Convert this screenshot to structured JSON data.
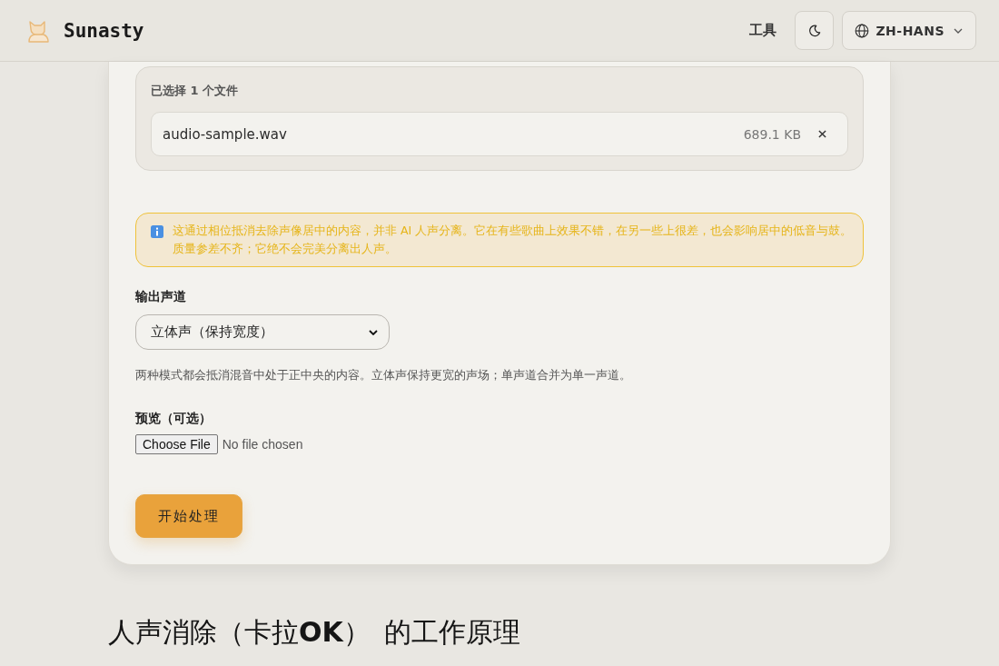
{
  "header": {
    "brand": "Sunasty",
    "nav_link": "工具",
    "language": {
      "label": "ZH-HANS"
    }
  },
  "file_panel": {
    "title": "已选择 1 个文件",
    "files": [
      {
        "name": "audio-sample.wav",
        "size": "689.1 KB"
      }
    ]
  },
  "notice": {
    "text": "这通过相位抵消去除声像居中的内容，并非 AI 人声分离。它在有些歌曲上效果不错，在另一些上很差，也会影响居中的低音与鼓。质量参差不齐；它绝不会完美分离出人声。"
  },
  "output_channel": {
    "label": "输出声道",
    "value": "立体声（保持宽度）",
    "help": "两种模式都会抵消混音中处于正中央的内容。立体声保持更宽的声场；单声道合并为单一声道。"
  },
  "preview": {
    "label": "预览（可选）",
    "button": "Choose File",
    "status": "No file chosen"
  },
  "submit": {
    "label": "开始处理"
  },
  "section_heading": "人声消除（卡拉**OK**）  的工作原理"
}
